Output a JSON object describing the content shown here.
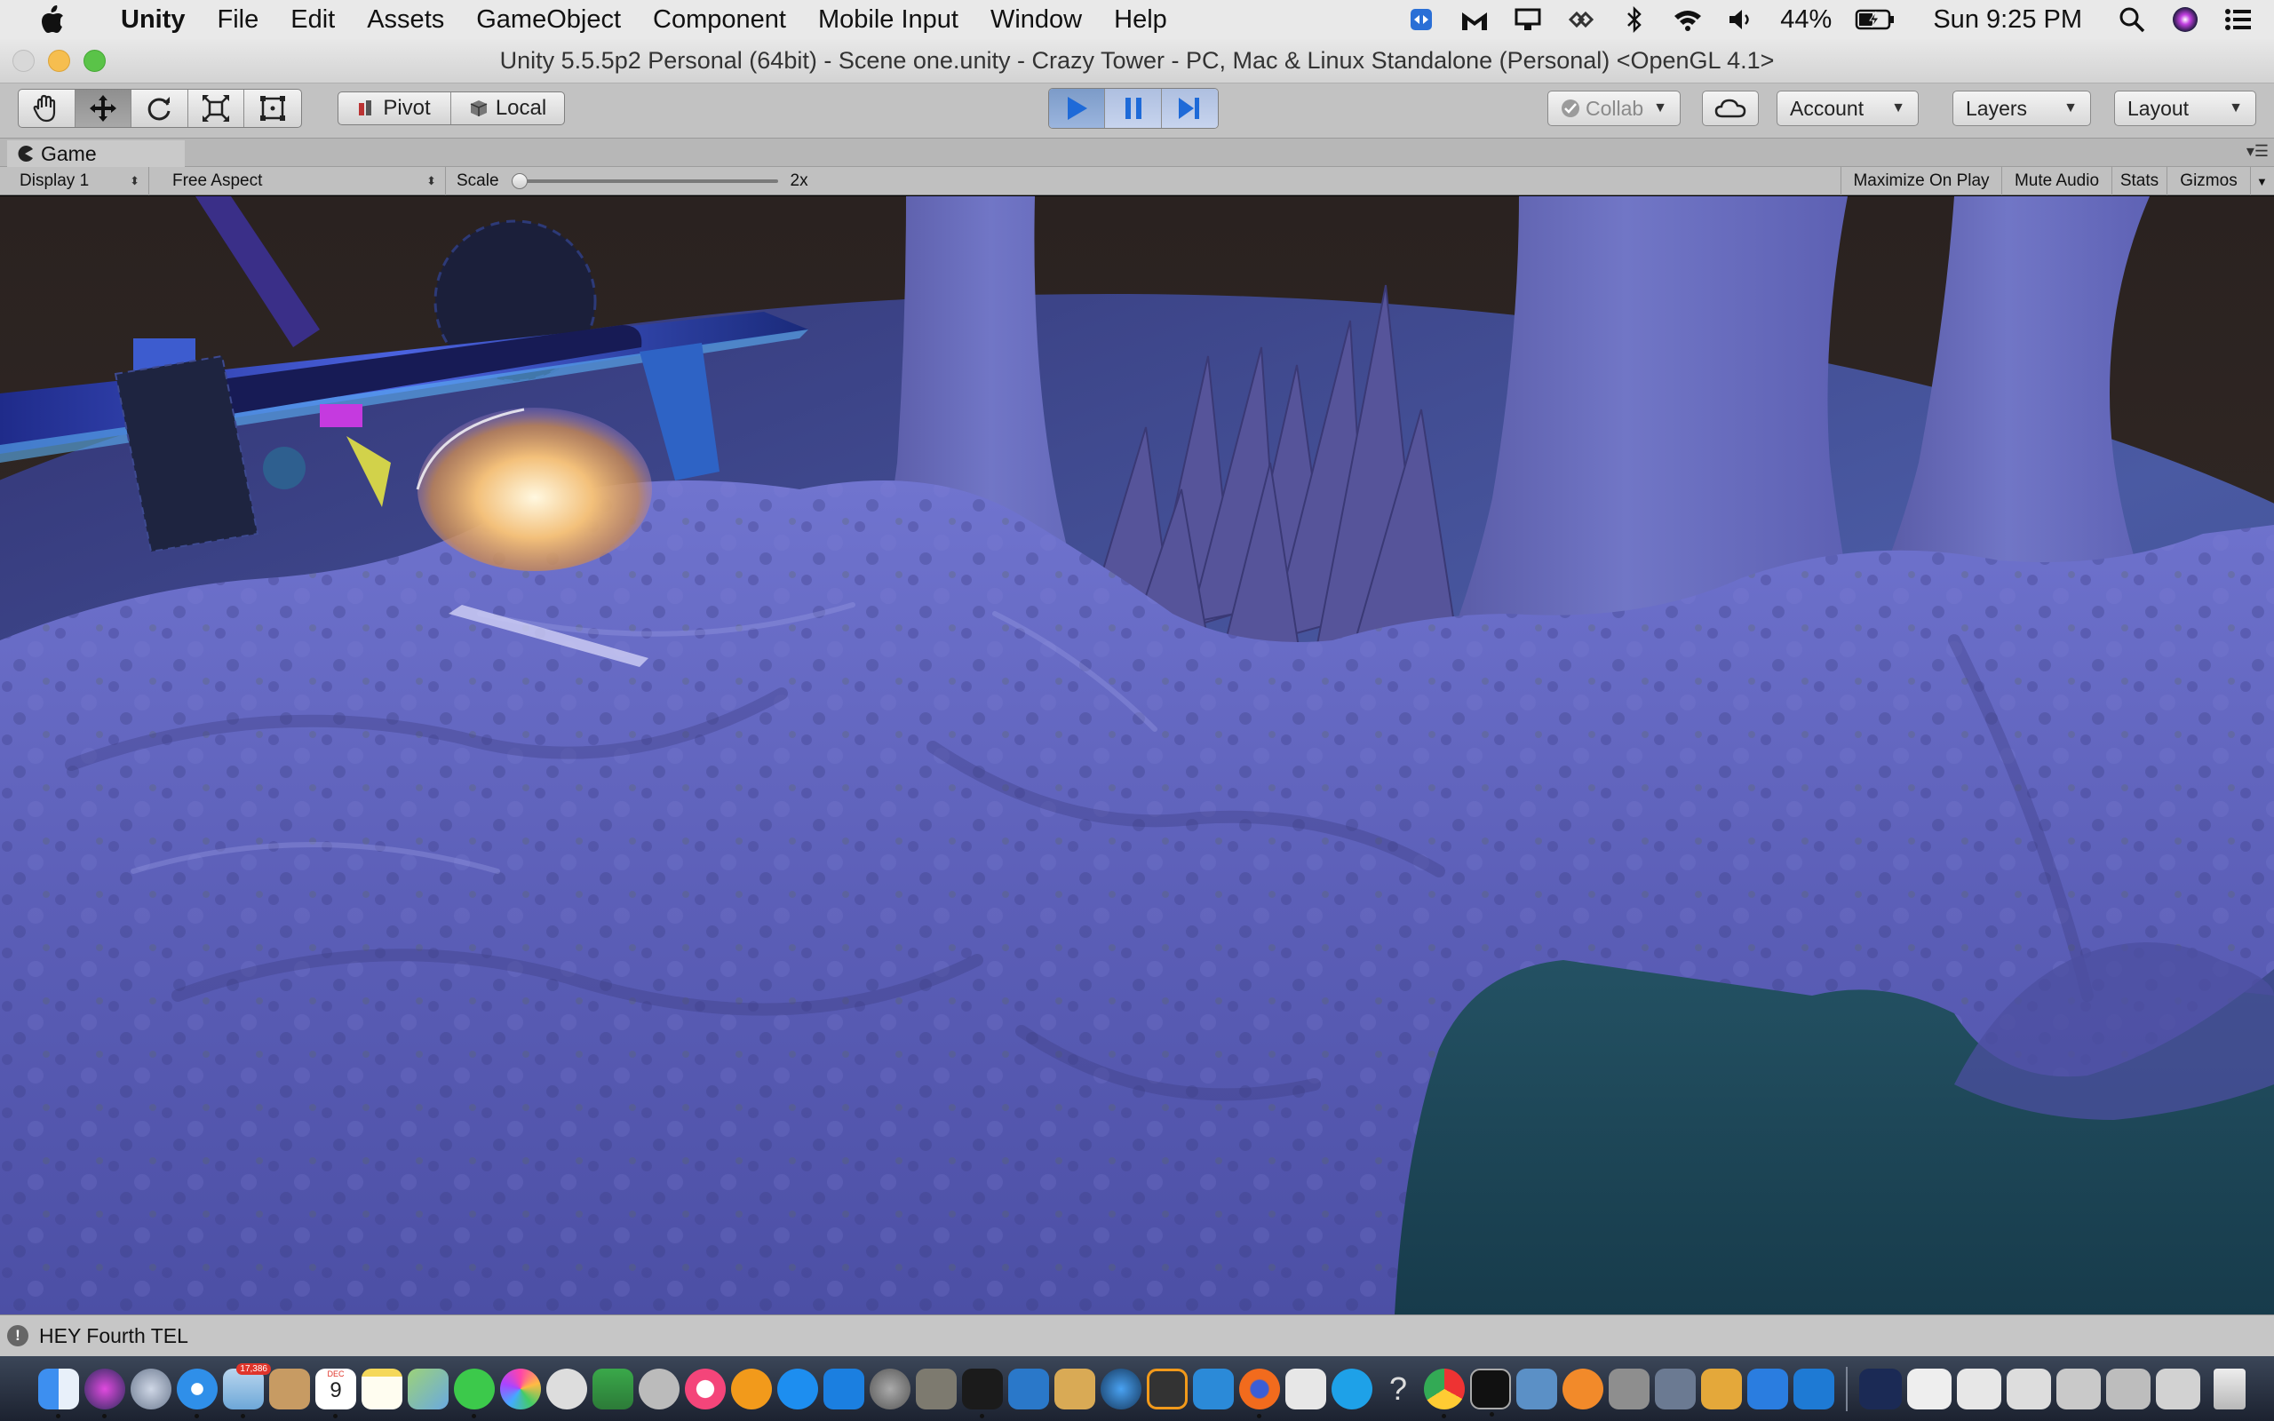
{
  "menubar": {
    "app_name": "Unity",
    "items": [
      "File",
      "Edit",
      "Assets",
      "GameObject",
      "Component",
      "Mobile Input",
      "Window",
      "Help"
    ],
    "battery": "44%",
    "clock": "Sun 9:25 PM"
  },
  "window": {
    "title": "Unity 5.5.5p2 Personal (64bit) - Scene one.unity - Crazy Tower - PC, Mac & Linux Standalone (Personal) <OpenGL 4.1>"
  },
  "toolbar": {
    "pivot_label": "Pivot",
    "local_label": "Local",
    "collab_label": "Collab",
    "account_label": "Account",
    "layers_label": "Layers",
    "layout_label": "Layout"
  },
  "game_panel": {
    "tab_label": "Game",
    "display_label": "Display 1",
    "aspect_label": "Free Aspect",
    "scale_label": "Scale",
    "scale_value": "2x",
    "maximize_label": "Maximize On Play",
    "mute_label": "Mute Audio",
    "stats_label": "Stats",
    "gizmos_label": "Gizmos"
  },
  "console": {
    "message": "HEY Fourth TEL"
  },
  "colors": {
    "terrain": "#6b6fc9",
    "water": "#1d4a5c",
    "play_accent": "#1e6ad8"
  },
  "dock": {
    "calendar_month": "DEC",
    "calendar_day": "9",
    "photos_badge": "17,386"
  }
}
